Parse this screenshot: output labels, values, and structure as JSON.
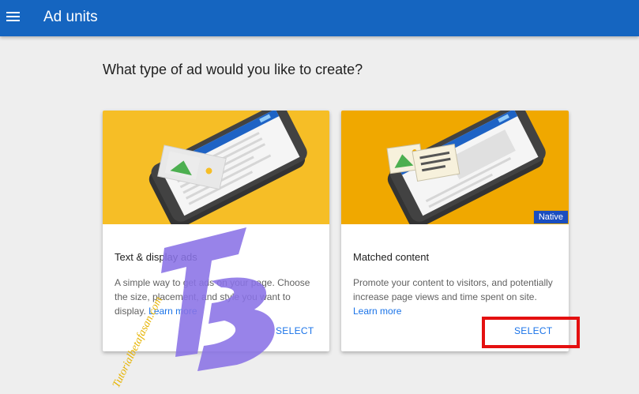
{
  "header": {
    "title": "Ad units",
    "menu_icon": "hamburger-menu-icon",
    "background": "#1565c0"
  },
  "main": {
    "question": "What type of ad would you like to create?"
  },
  "cards": [
    {
      "title": "Text & display ads",
      "description": "A simple way to get ads on your page. Choose the size, placement, and style you want to display.",
      "learn_more": "Learn more",
      "select_label": "SELECT",
      "art_color": "#f6be26"
    },
    {
      "title": "Matched content",
      "description": "Promote your content to visitors, and potentially increase page views and time spent on site.",
      "learn_more": "Learn more",
      "select_label": "SELECT",
      "badge": "Native",
      "art_color": "#f0a800"
    }
  ],
  "watermark": {
    "text": "Tutorialbetafasan.com",
    "color": "#8a73e6"
  }
}
